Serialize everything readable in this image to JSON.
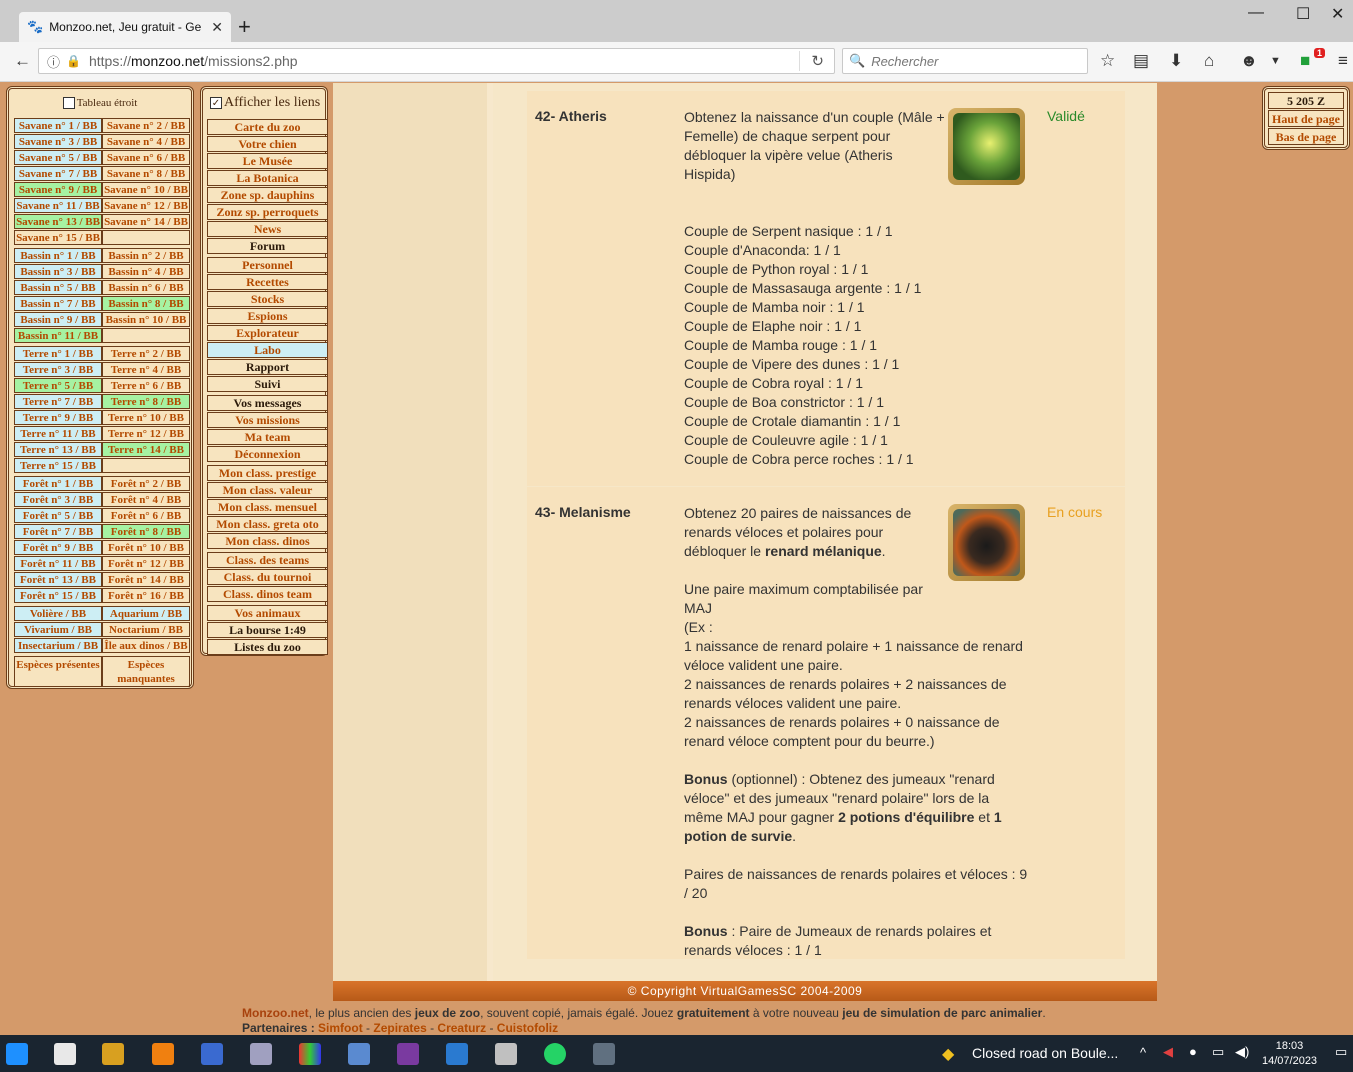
{
  "browser": {
    "tab_title": "Monzoo.net, Jeu gratuit - Ge",
    "url_prefix": "https://",
    "url_host": "monzoo.net",
    "url_path": "/missions2.php",
    "search_placeholder": "Rechercher",
    "notification_count": "1"
  },
  "left_panel": {
    "narrow_label": "Tableau étroit",
    "enclosures": [
      [
        "Savane n° 1 / BB",
        "Savane n° 2 / BB",
        "b",
        "e"
      ],
      [
        "Savane n° 3 / BB",
        "Savane n° 4 / BB",
        "b",
        "e"
      ],
      [
        "Savane n° 5 / BB",
        "Savane n° 6 / BB",
        "b",
        "e"
      ],
      [
        "Savane n° 7 / BB",
        "Savane n° 8 / BB",
        "b",
        "e"
      ],
      [
        "Savane n° 9 / BB",
        "Savane n° 10 / BB",
        "g",
        "e"
      ],
      [
        "Savane n° 11 / BB",
        "Savane n° 12 / BB",
        "b",
        "e"
      ],
      [
        "Savane n° 13 / BB",
        "Savane n° 14 / BB",
        "g",
        "e"
      ],
      [
        "Savane n° 15 / BB",
        "",
        "e",
        "e"
      ],
      [
        "Bassin n° 1 / BB",
        "Bassin n° 2 / BB",
        "b",
        "e"
      ],
      [
        "Bassin n° 3 / BB",
        "Bassin n° 4 / BB",
        "b",
        "e"
      ],
      [
        "Bassin n° 5 / BB",
        "Bassin n° 6 / BB",
        "b",
        "e"
      ],
      [
        "Bassin n° 7 / BB",
        "Bassin n° 8 / BB",
        "b",
        "g"
      ],
      [
        "Bassin n° 9 / BB",
        "Bassin n° 10 / BB",
        "b",
        "e"
      ],
      [
        "Bassin n° 11 / BB",
        "",
        "g",
        "e"
      ],
      [
        "Terre n° 1 / BB",
        "Terre n° 2 / BB",
        "b",
        "e"
      ],
      [
        "Terre n° 3 / BB",
        "Terre n° 4 / BB",
        "b",
        "e"
      ],
      [
        "Terre n° 5 / BB",
        "Terre n° 6 / BB",
        "g",
        "e"
      ],
      [
        "Terre n° 7 / BB",
        "Terre n° 8 / BB",
        "b",
        "g"
      ],
      [
        "Terre n° 9 / BB",
        "Terre n° 10 / BB",
        "b",
        "e"
      ],
      [
        "Terre n° 11 / BB",
        "Terre n° 12 / BB",
        "b",
        "e"
      ],
      [
        "Terre n° 13 / BB",
        "Terre n° 14 / BB",
        "b",
        "g"
      ],
      [
        "Terre n° 15 / BB",
        "",
        "b",
        "e"
      ],
      [
        "Forêt n° 1 / BB",
        "Forêt n° 2 / BB",
        "b",
        "e"
      ],
      [
        "Forêt n° 3 / BB",
        "Forêt n° 4 / BB",
        "b",
        "e"
      ],
      [
        "Forêt n° 5 / BB",
        "Forêt n° 6 / BB",
        "b",
        "e"
      ],
      [
        "Forêt n° 7 / BB",
        "Forêt n° 8 / BB",
        "b",
        "g"
      ],
      [
        "Forêt n° 9 / BB",
        "Forêt n° 10 / BB",
        "b",
        "e"
      ],
      [
        "Forêt n° 11 / BB",
        "Forêt n° 12 / BB",
        "b",
        "e"
      ],
      [
        "Forêt n° 13 / BB",
        "Forêt n° 14 / BB",
        "b",
        "e"
      ],
      [
        "Forêt n° 15 / BB",
        "Forêt n° 16 / BB",
        "b",
        "e"
      ],
      [
        "Volière / BB",
        "Aquarium / BB",
        "b",
        "b"
      ],
      [
        "Vivarium / BB",
        "Noctarium / BB",
        "b",
        "e"
      ],
      [
        "Insectarium / BB",
        "Île aux dinos / BB",
        "b",
        "e"
      ]
    ],
    "species_present": "Espèces présentes",
    "species_missing": "Espèces manquantes"
  },
  "links_panel": {
    "show_links_label": "Afficher les liens",
    "links": [
      [
        "Carte du zoo",
        ""
      ],
      [
        "Votre chien",
        ""
      ],
      [
        "Le Musée",
        ""
      ],
      [
        "La Botanica",
        ""
      ],
      [
        "Zone sp. dauphins",
        ""
      ],
      [
        "Zonz sp. perroquets",
        ""
      ],
      [
        "News",
        ""
      ],
      [
        "Forum",
        "dark"
      ],
      [
        "Personnel",
        ""
      ],
      [
        "Recettes",
        ""
      ],
      [
        "Stocks",
        ""
      ],
      [
        "Espions",
        ""
      ],
      [
        "Explorateur",
        ""
      ],
      [
        "Labo",
        "blue"
      ],
      [
        "Rapport",
        "dark"
      ],
      [
        "Suivi",
        "dark"
      ],
      [
        "Vos messages",
        "dark"
      ],
      [
        "Vos missions",
        ""
      ],
      [
        "Ma team",
        ""
      ],
      [
        "Déconnexion",
        ""
      ],
      [
        "Mon class. prestige",
        ""
      ],
      [
        "Mon class. valeur",
        ""
      ],
      [
        "Mon class. mensuel",
        ""
      ],
      [
        "Mon class. greta oto",
        ""
      ],
      [
        "Mon class. dinos",
        ""
      ],
      [
        "Class. des teams",
        ""
      ],
      [
        "Class. du tournoi",
        ""
      ],
      [
        "Class. dinos team",
        ""
      ],
      [
        "Vos animaux",
        ""
      ],
      [
        "La bourse 1:49",
        "dark"
      ],
      [
        "Listes du zoo",
        "dark"
      ]
    ]
  },
  "right_panel": {
    "money": "5 205 Z",
    "top_link": "Haut de page",
    "bottom_link": "Bas de page"
  },
  "missions": [
    {
      "number": "42- Atheris",
      "status": "Validé",
      "status_color": "#2a8a2a",
      "description": "Obtenez la naissance d'un couple (Mâle + Femelle) de chaque serpent pour débloquer la vipère velue (Atheris Hispida)",
      "progress": [
        "Couple de Serpent nasique : 1 / 1",
        "Couple d'Anaconda: 1 / 1",
        "Couple de Python royal : 1 / 1",
        "Couple de Massasauga argente : 1 / 1",
        "Couple de Mamba noir : 1 / 1",
        "Couple de Elaphe noir : 1 / 1",
        "Couple de Mamba rouge : 1 / 1",
        "Couple de Vipere des dunes : 1 / 1",
        "Couple de Cobra royal : 1 / 1",
        "Couple de Boa constrictor : 1 / 1",
        "Couple de Crotale diamantin : 1 / 1",
        "Couple de Couleuvre agile : 1 / 1",
        "Couple de Cobra perce roches : 1 / 1"
      ]
    },
    {
      "number": "43- Melanisme",
      "status": "En cours",
      "status_color": "#e8a020",
      "intro": "Obtenez 20 paires de naissances de renards véloces et polaires pour débloquer le ",
      "intro_bold": "renard mélanique",
      "intro_end": ".",
      "rule": "Une paire maximum comptabilisée par MAJ",
      "example_open": "(Ex :",
      "example_1": "1 naissance de renard polaire + 1 naissance de renard véloce valident une paire.",
      "example_2": "2 naissances de renards polaires + 2 naissances de renards véloces valident une paire.",
      "example_3": "2 naissances de renards polaires + 0 naissance de renard véloce comptent pour du beurre.)",
      "bonus_label": "Bonus",
      "bonus_text": " (optionnel) : Obtenez des jumeaux \"renard véloce\" et des jumeaux \"renard polaire\" lors de la même MAJ pour gagner ",
      "bonus_reward_1": "2 potions d'équilibre",
      "bonus_and": " et ",
      "bonus_reward_2": "1 potion de survie",
      "bonus_end": ".",
      "pairs_progress": "Paires de naissances de renards polaires et véloces : 9 / 20",
      "bonus2_label": "Bonus",
      "bonus2_text": " : Paire de Jumeaux de renards polaires et renards véloces : 1 / 1"
    }
  ],
  "copyright": "© Copyright VirtualGamesSC 2004-2009",
  "footer": {
    "brand": "Monzoo.net",
    "text1": ", le plus ancien des ",
    "bold1": "jeux de zoo",
    "text2": ", souvent copié, jamais égalé. Jouez ",
    "bold2": "gratuitement",
    "text3": " à votre nouveau ",
    "bold3": "jeu de simulation de parc animalier",
    "text4": ".",
    "partners_label": "Partenaires : ",
    "partners": [
      "Simfoot",
      "Zepirates",
      "Creaturz",
      "Cuistofoliz"
    ],
    "sep": " - "
  },
  "taskbar": {
    "notification": "Closed road on Boule...",
    "time": "18:03",
    "date": "14/07/2023"
  }
}
